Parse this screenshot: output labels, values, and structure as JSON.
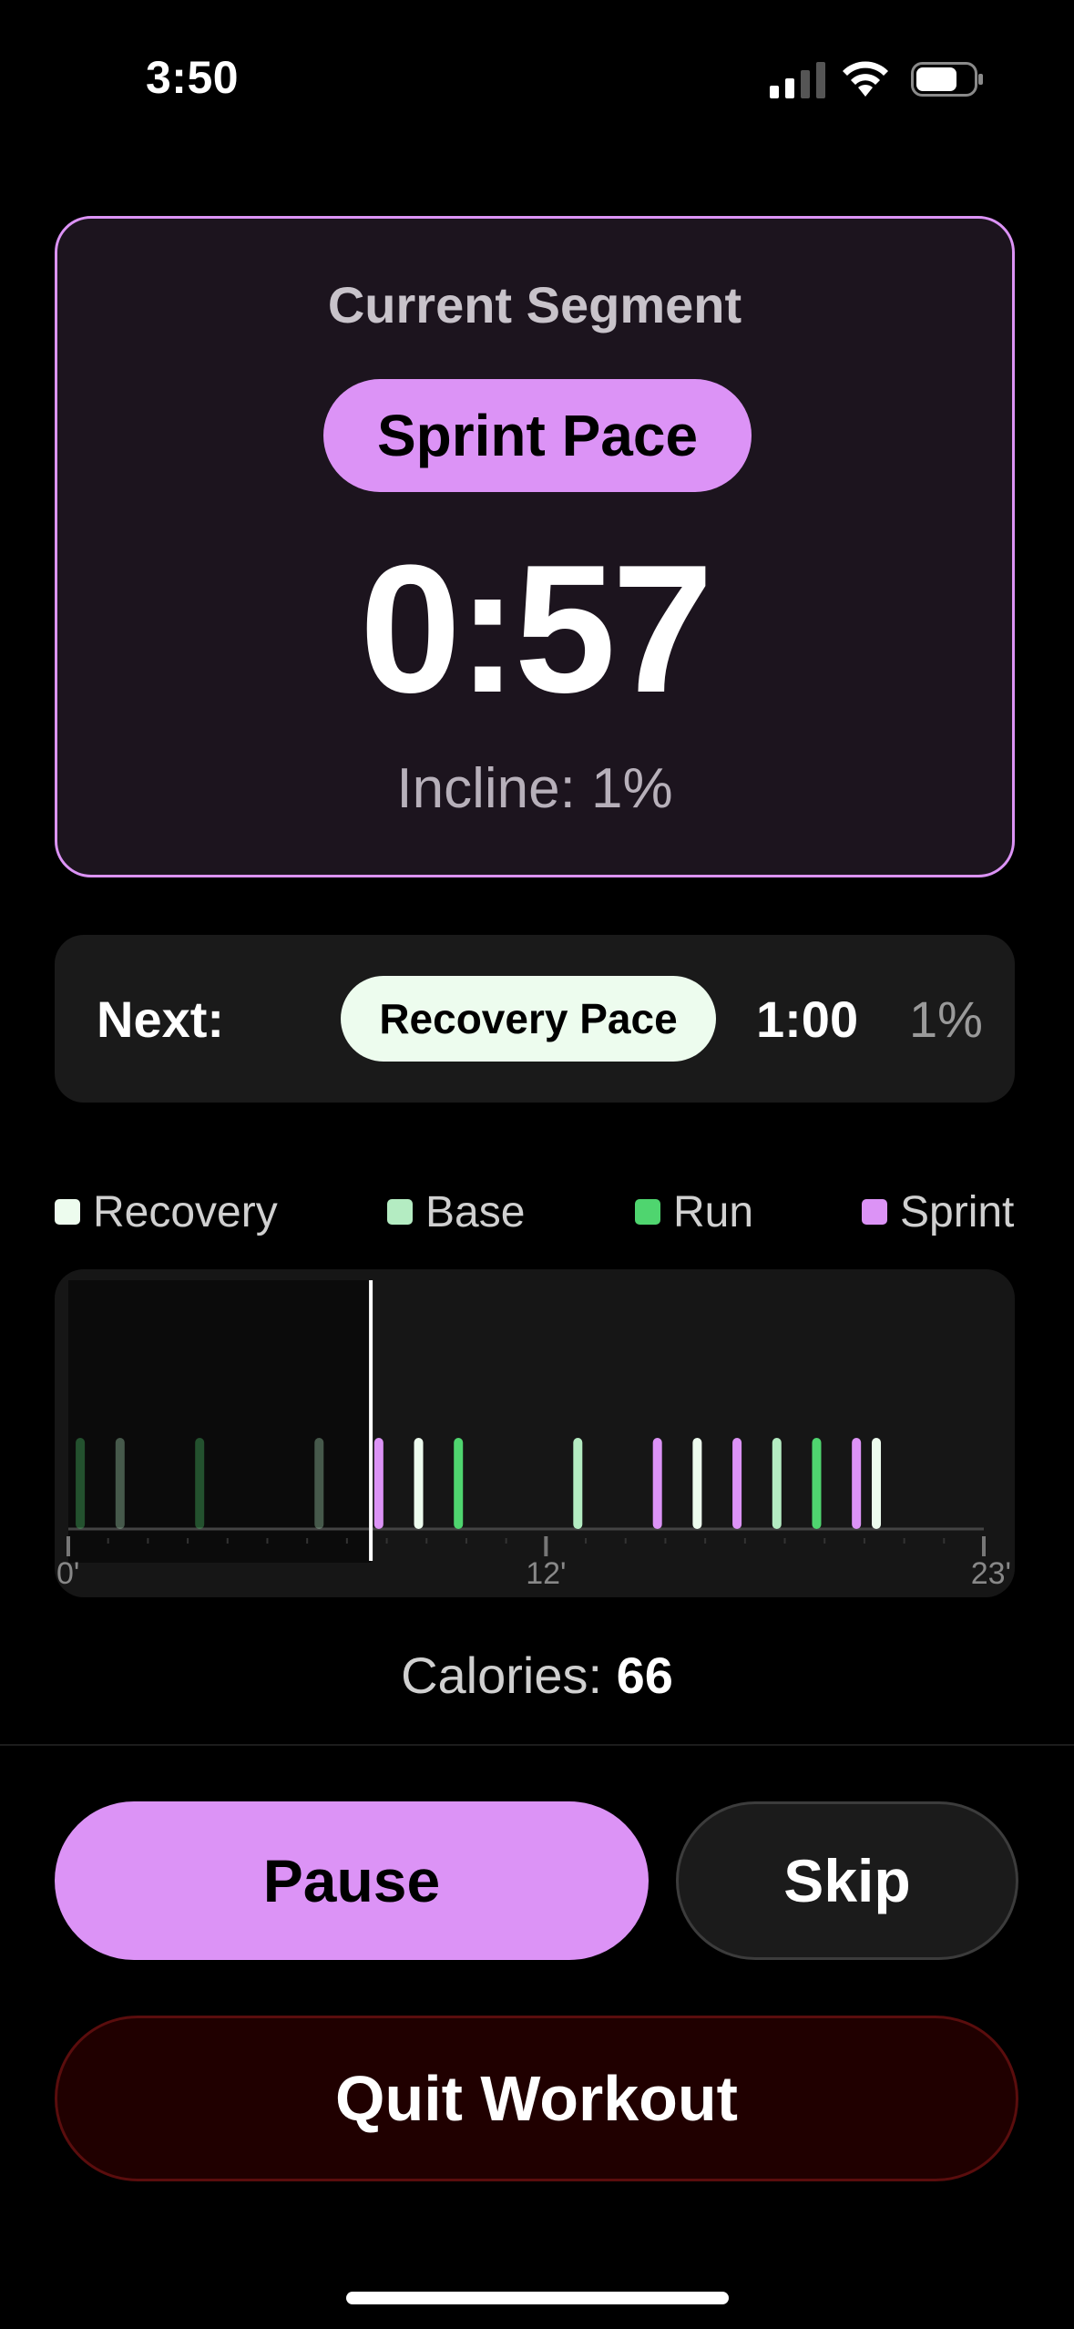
{
  "status_bar": {
    "time": "3:50",
    "signal_icon": "cellular-signal-icon",
    "wifi_icon": "wifi-icon",
    "battery_icon": "battery-icon"
  },
  "current_segment": {
    "title": "Current Segment",
    "pace": "Sprint Pace",
    "timer": "0:57",
    "incline": "Incline: 1%",
    "accent_color": "#dc93f6"
  },
  "next_segment": {
    "label": "Next:",
    "pace": "Recovery Pace",
    "duration": "1:00",
    "incline": "1%"
  },
  "legend": [
    {
      "label": "Recovery",
      "color": "#edfcee"
    },
    {
      "label": "Base",
      "color": "#b4ecc2"
    },
    {
      "label": "Run",
      "color": "#4fd56f"
    },
    {
      "label": "Sprint",
      "color": "#dc93f6"
    }
  ],
  "chart_data": {
    "type": "bar",
    "x_tick_labels": [
      "0'",
      "12'",
      "23'"
    ],
    "x_range": [
      0,
      23
    ],
    "current_position_min": 7.6,
    "segments": [
      {
        "x": 0.3,
        "type": "Run",
        "completed": true
      },
      {
        "x": 1.3,
        "type": "Base",
        "completed": true
      },
      {
        "x": 3.3,
        "type": "Run",
        "completed": true
      },
      {
        "x": 6.3,
        "type": "Base",
        "completed": true
      },
      {
        "x": 7.8,
        "type": "Sprint",
        "completed": false
      },
      {
        "x": 8.8,
        "type": "Recovery",
        "completed": false
      },
      {
        "x": 9.8,
        "type": "Run",
        "completed": false
      },
      {
        "x": 12.8,
        "type": "Base",
        "completed": false
      },
      {
        "x": 14.8,
        "type": "Sprint",
        "completed": false
      },
      {
        "x": 15.8,
        "type": "Recovery",
        "completed": false
      },
      {
        "x": 16.8,
        "type": "Sprint",
        "completed": false
      },
      {
        "x": 17.8,
        "type": "Base",
        "completed": false
      },
      {
        "x": 18.8,
        "type": "Run",
        "completed": false
      },
      {
        "x": 19.8,
        "type": "Sprint",
        "completed": false
      },
      {
        "x": 20.3,
        "type": "Recovery",
        "completed": false
      }
    ]
  },
  "calories": {
    "label": "Calories:",
    "value": "66"
  },
  "actions": {
    "pause": "Pause",
    "skip": "Skip",
    "quit": "Quit Workout",
    "quit_color": "#200000"
  }
}
